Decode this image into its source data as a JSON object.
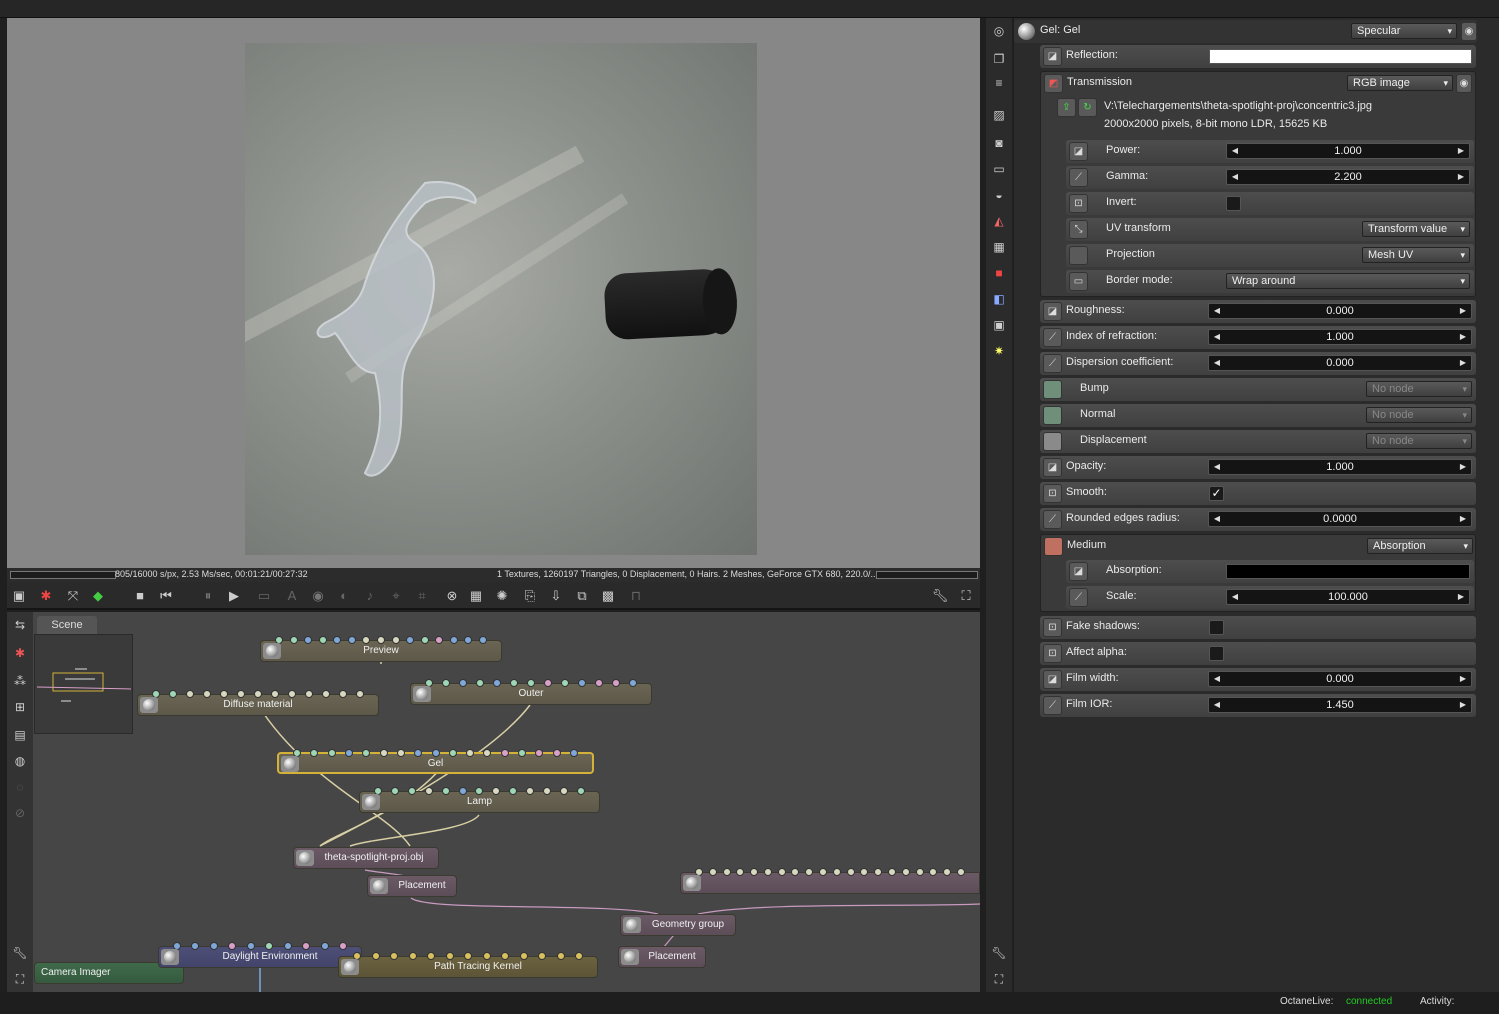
{
  "viewport": {
    "status_left": "805/16000 s/px, 2.53 Ms/sec, 00:01:21/00:27:32",
    "status_right": "1 Textures, 1260197 Triangles, 0 Displacement, 0 Hairs. 2 Meshes, GeForce GTX 680, 220.0/..."
  },
  "graph": {
    "tab": "Scene",
    "nodes": {
      "preview": "Preview",
      "diffuse": "Diffuse material",
      "outer": "Outer",
      "gel": "Gel",
      "lamp": "Lamp",
      "obj": "theta-spotlight-proj.obj",
      "placement1": "Placement",
      "geometry_group": "Geometry group",
      "placement2": "Placement",
      "camera_imager": "Camera Imager",
      "daylight": "Daylight Environment",
      "kernel": "Path Tracing Kernel"
    }
  },
  "inspector": {
    "title": "Gel: Gel",
    "material_type": "Specular",
    "reflection_label": "Reflection:",
    "transmission_label": "Transmission",
    "transmission_type": "RGB image",
    "file_path": "V:\\Telechargements\\theta-spotlight-proj\\concentric3.jpg",
    "file_info": "2000x2000 pixels, 8-bit mono LDR, 15625 KB",
    "power_label": "Power:",
    "power_value": "1.000",
    "gamma_label": "Gamma:",
    "gamma_value": "2.200",
    "invert_label": "Invert:",
    "uv_label": "UV transform",
    "uv_value": "Transform value",
    "projection_label": "Projection",
    "projection_value": "Mesh UV",
    "border_label": "Border mode:",
    "border_value": "Wrap around",
    "roughness_label": "Roughness:",
    "roughness_value": "0.000",
    "ior_label": "Index of refraction:",
    "ior_value": "1.000",
    "dispersion_label": "Dispersion coefficient:",
    "dispersion_value": "0.000",
    "bump_label": "Bump",
    "normal_label": "Normal",
    "displacement_label": "Displacement",
    "no_node": "No node",
    "opacity_label": "Opacity:",
    "opacity_value": "1.000",
    "smooth_label": "Smooth:",
    "rounded_label": "Rounded edges radius:",
    "rounded_value": "0.0000",
    "medium_label": "Medium",
    "medium_value": "Absorption",
    "absorption_label": "Absorption:",
    "scale_label": "Scale:",
    "scale_value": "100.000",
    "fake_shadows_label": "Fake shadows:",
    "affect_alpha_label": "Affect alpha:",
    "film_width_label": "Film width:",
    "film_width_value": "0.000",
    "film_ior_label": "Film IOR:",
    "film_ior_value": "1.450",
    "smooth_checked": true
  },
  "footer": {
    "octane_live_label": "OctaneLive:",
    "octane_live_status": "connected",
    "activity_label": "Activity:"
  },
  "colors": {
    "connected": "#22cc22",
    "gel_node_border": "#d4b23a"
  }
}
